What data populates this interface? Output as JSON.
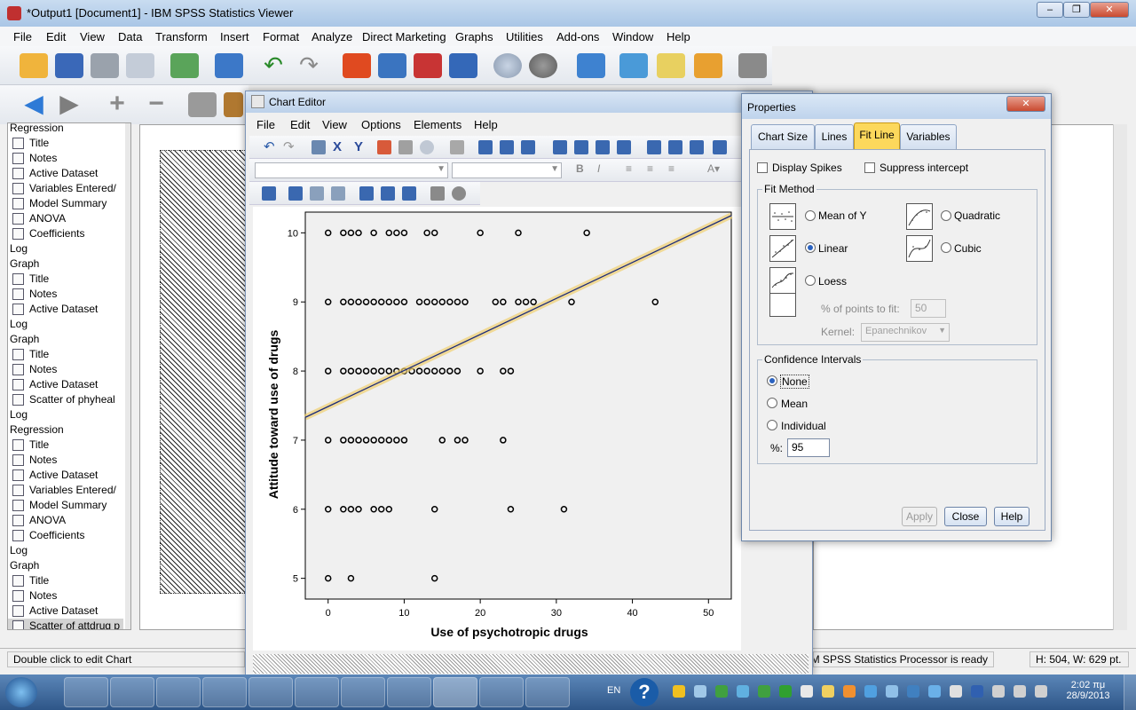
{
  "viewer": {
    "title": "*Output1 [Document1] - IBM SPSS Statistics Viewer",
    "menu": [
      "File",
      "Edit",
      "View",
      "Data",
      "Transform",
      "Insert",
      "Format",
      "Analyze",
      "Direct Marketing",
      "Graphs",
      "Utilities",
      "Add-ons",
      "Window",
      "Help"
    ],
    "outline": [
      {
        "label": "Regression",
        "type": "header"
      },
      {
        "label": "Title"
      },
      {
        "label": "Notes"
      },
      {
        "label": "Active Dataset"
      },
      {
        "label": "Variables Entered/"
      },
      {
        "label": "Model Summary"
      },
      {
        "label": "ANOVA"
      },
      {
        "label": "Coefficients"
      },
      {
        "label": "Log",
        "type": "header"
      },
      {
        "label": "Graph",
        "type": "header"
      },
      {
        "label": "Title"
      },
      {
        "label": "Notes"
      },
      {
        "label": "Active Dataset"
      },
      {
        "label": "Log",
        "type": "header"
      },
      {
        "label": "Graph",
        "type": "header"
      },
      {
        "label": "Title"
      },
      {
        "label": "Notes"
      },
      {
        "label": "Active Dataset"
      },
      {
        "label": "Scatter of phyheal"
      },
      {
        "label": "Log",
        "type": "header"
      },
      {
        "label": "Regression",
        "type": "header"
      },
      {
        "label": "Title"
      },
      {
        "label": "Notes"
      },
      {
        "label": "Active Dataset"
      },
      {
        "label": "Variables Entered/"
      },
      {
        "label": "Model Summary"
      },
      {
        "label": "ANOVA"
      },
      {
        "label": "Coefficients"
      },
      {
        "label": "Log",
        "type": "header"
      },
      {
        "label": "Graph",
        "type": "header"
      },
      {
        "label": "Title"
      },
      {
        "label": "Notes"
      },
      {
        "label": "Active Dataset"
      },
      {
        "label": "Scatter of attdrug p",
        "selected": true
      }
    ],
    "status_left": "Double click to edit Chart",
    "status_processor": "IBM SPSS Statistics Processor is ready",
    "status_size": "H: 504, W: 629 pt."
  },
  "chart_editor": {
    "title": "Chart Editor",
    "menu": [
      "File",
      "Edit",
      "View",
      "Options",
      "Elements",
      "Help"
    ]
  },
  "chart_data": {
    "type": "scatter",
    "xlabel": "Use of psychotropic drugs",
    "ylabel": "Attitude toward use of drugs",
    "xlim": [
      -3,
      53
    ],
    "ylim": [
      4.7,
      10.3
    ],
    "xticks": [
      0,
      10,
      20,
      30,
      40,
      50
    ],
    "yticks": [
      5,
      6,
      7,
      8,
      9,
      10
    ],
    "fit_line": {
      "x": [
        -3,
        53
      ],
      "y": [
        7.33,
        10.25
      ]
    },
    "points": [
      [
        0,
        10
      ],
      [
        2,
        10
      ],
      [
        3,
        10
      ],
      [
        4,
        10
      ],
      [
        6,
        10
      ],
      [
        8,
        10
      ],
      [
        9,
        10
      ],
      [
        10,
        10
      ],
      [
        13,
        10
      ],
      [
        14,
        10
      ],
      [
        20,
        10
      ],
      [
        25,
        10
      ],
      [
        34,
        10
      ],
      [
        0,
        9
      ],
      [
        2,
        9
      ],
      [
        3,
        9
      ],
      [
        4,
        9
      ],
      [
        5,
        9
      ],
      [
        6,
        9
      ],
      [
        7,
        9
      ],
      [
        8,
        9
      ],
      [
        9,
        9
      ],
      [
        10,
        9
      ],
      [
        12,
        9
      ],
      [
        13,
        9
      ],
      [
        14,
        9
      ],
      [
        15,
        9
      ],
      [
        16,
        9
      ],
      [
        17,
        9
      ],
      [
        18,
        9
      ],
      [
        22,
        9
      ],
      [
        23,
        9
      ],
      [
        25,
        9
      ],
      [
        26,
        9
      ],
      [
        27,
        9
      ],
      [
        32,
        9
      ],
      [
        43,
        9
      ],
      [
        0,
        8
      ],
      [
        2,
        8
      ],
      [
        3,
        8
      ],
      [
        4,
        8
      ],
      [
        5,
        8
      ],
      [
        6,
        8
      ],
      [
        7,
        8
      ],
      [
        8,
        8
      ],
      [
        9,
        8
      ],
      [
        10,
        8
      ],
      [
        11,
        8
      ],
      [
        12,
        8
      ],
      [
        13,
        8
      ],
      [
        14,
        8
      ],
      [
        15,
        8
      ],
      [
        16,
        8
      ],
      [
        17,
        8
      ],
      [
        20,
        8
      ],
      [
        23,
        8
      ],
      [
        24,
        8
      ],
      [
        0,
        7
      ],
      [
        2,
        7
      ],
      [
        3,
        7
      ],
      [
        4,
        7
      ],
      [
        5,
        7
      ],
      [
        6,
        7
      ],
      [
        7,
        7
      ],
      [
        8,
        7
      ],
      [
        9,
        7
      ],
      [
        10,
        7
      ],
      [
        15,
        7
      ],
      [
        17,
        7
      ],
      [
        18,
        7
      ],
      [
        23,
        7
      ],
      [
        0,
        6
      ],
      [
        2,
        6
      ],
      [
        3,
        6
      ],
      [
        4,
        6
      ],
      [
        6,
        6
      ],
      [
        7,
        6
      ],
      [
        8,
        6
      ],
      [
        14,
        6
      ],
      [
        24,
        6
      ],
      [
        31,
        6
      ],
      [
        0,
        5
      ],
      [
        3,
        5
      ],
      [
        14,
        5
      ]
    ]
  },
  "properties": {
    "title": "Properties",
    "tabs": [
      "Chart Size",
      "Lines",
      "Fit Line",
      "Variables"
    ],
    "active_tab": "Fit Line",
    "display_spikes": "Display Spikes",
    "suppress_intercept": "Suppress intercept",
    "fit_method_legend": "Fit Method",
    "methods": [
      "Mean of Y",
      "Quadratic",
      "Linear",
      "Cubic",
      "Loess"
    ],
    "selected_method": "Linear",
    "points_to_fit_label": "% of points to fit:",
    "points_to_fit_value": "50",
    "kernel_label": "Kernel:",
    "kernel_value": "Epanechnikov",
    "ci_legend": "Confidence Intervals",
    "ci_options": [
      "None",
      "Mean",
      "Individual"
    ],
    "ci_selected": "None",
    "percent_label": "%:",
    "percent_value": "95",
    "apply": "Apply",
    "close": "Close",
    "help": "Help"
  },
  "taskbar": {
    "lang": "EN",
    "time": "2:02 πμ",
    "date": "28/9/2013"
  }
}
